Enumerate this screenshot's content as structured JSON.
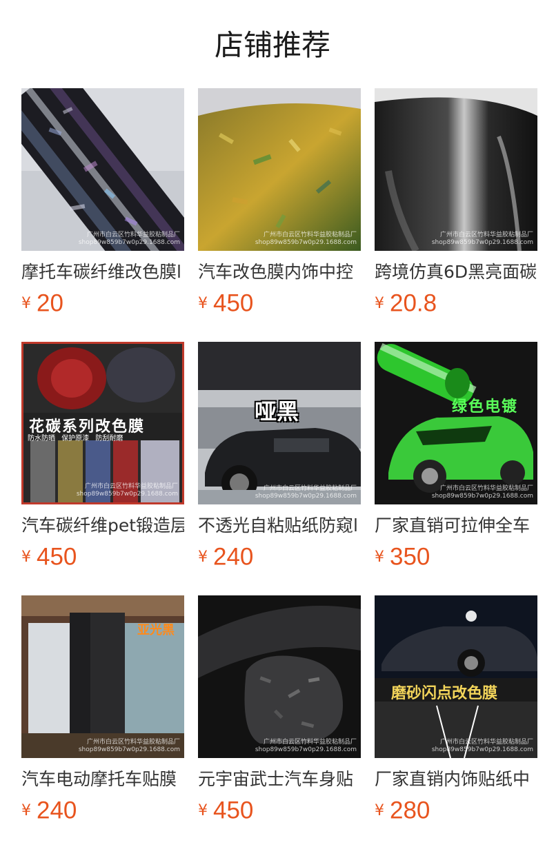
{
  "header": {
    "title": "店铺推荐"
  },
  "products": [
    {
      "title": "摩托车碳纤维改色膜l",
      "currency": "¥",
      "price": "20",
      "watermark": "广州市白云区竹料华益胶粘制品厂\nshop89w859b7w0p29.1688.com",
      "overlay": ""
    },
    {
      "title": "汽车改色膜内饰中控",
      "currency": "¥",
      "price": "450",
      "watermark": "广州市白云区竹料华益胶粘制品厂\nshop89w859b7w0p29.1688.com",
      "overlay": ""
    },
    {
      "title": "跨境仿真6D黑亮面碳",
      "currency": "¥",
      "price": "20.8",
      "watermark": "广州市白云区竹料华益胶粘制品厂\nshop89w859b7w0p29.1688.com",
      "overlay": ""
    },
    {
      "title": "汽车碳纤维pet锻造层",
      "currency": "¥",
      "price": "450",
      "watermark": "广州市白云区竹料华益胶粘制品厂\nshop89w859b7w0p29.1688.com",
      "overlay": "花碳系列改色膜",
      "overlay_sub": [
        "防水防晒",
        "保护原漆",
        "防刮耐磨"
      ]
    },
    {
      "title": "不透光自粘贴纸防窥l",
      "currency": "¥",
      "price": "240",
      "watermark": "广州市白云区竹料华益胶粘制品厂\nshop89w859b7w0p29.1688.com",
      "overlay": "哑黑"
    },
    {
      "title": "厂家直销可拉伸全车",
      "currency": "¥",
      "price": "350",
      "watermark": "广州市白云区竹料华益胶粘制品厂\nshop89w859b7w0p29.1688.com",
      "overlay": "绿色电镀"
    },
    {
      "title": "汽车电动摩托车贴膜",
      "currency": "¥",
      "price": "240",
      "watermark": "广州市白云区竹料华益胶粘制品厂\nshop89w859b7w0p29.1688.com",
      "overlay": "亚光黑"
    },
    {
      "title": "元宇宙武士汽车身贴",
      "currency": "¥",
      "price": "450",
      "watermark": "广州市白云区竹料华益胶粘制品厂\nshop89w859b7w0p29.1688.com",
      "overlay": ""
    },
    {
      "title": "厂家直销内饰贴纸中",
      "currency": "¥",
      "price": "280",
      "watermark": "广州市白云区竹料华益胶粘制品厂\nshop89w859b7w0p29.1688.com",
      "overlay": "磨砂闪点改色膜"
    }
  ],
  "colors": {
    "price": "#e8541e",
    "title": "#333333",
    "heading": "#1a1a1a"
  }
}
